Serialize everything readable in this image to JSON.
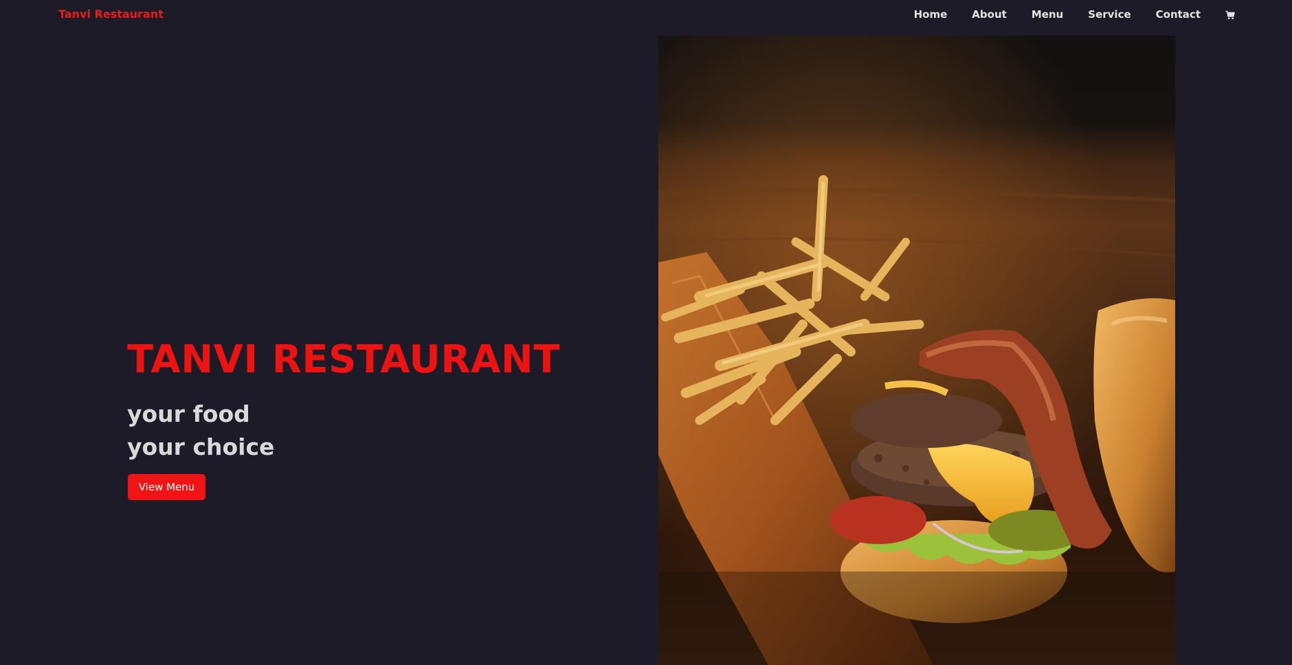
{
  "brand": "Tanvi Restaurant",
  "nav": {
    "home": "Home",
    "about": "About",
    "menu": "Menu",
    "service": "Service",
    "contact": "Contact",
    "cart_icon": "shopping-cart-icon"
  },
  "hero": {
    "title": "TANVI RESTAURANT",
    "tagline_line1": "your food",
    "tagline_line2": "your choice",
    "cta": "View Menu",
    "image": "burger-and-fries-photo"
  },
  "colors": {
    "background": "#1e1b29",
    "accent": "#ec1313",
    "text": "#e4e4e4"
  }
}
